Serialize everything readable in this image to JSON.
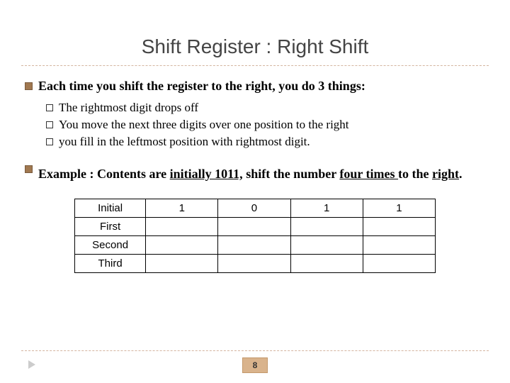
{
  "title": "Shift Register : Right Shift",
  "bullet1": "Each time you shift the register to the right, you do 3 things:",
  "sub": {
    "a": "The rightmost digit drops off",
    "b": "You move the next three digits over one position to the right",
    "c": "you fill in the leftmost position with rightmost digit."
  },
  "example": {
    "pre": "Example : Contents are ",
    "u1": "initially 1011,",
    "mid": "  shift the number ",
    "u2": "four times ",
    "post": "to the ",
    "u3": "right",
    "dot": "."
  },
  "table": {
    "rows": [
      "Initial",
      "First",
      "Second",
      "Third"
    ],
    "cells": {
      "r0": [
        "1",
        "0",
        "1",
        "1"
      ],
      "r1": [
        "",
        "",
        "",
        ""
      ],
      "r2": [
        "",
        "",
        "",
        ""
      ],
      "r3": [
        "",
        "",
        "",
        ""
      ]
    }
  },
  "page": "8"
}
